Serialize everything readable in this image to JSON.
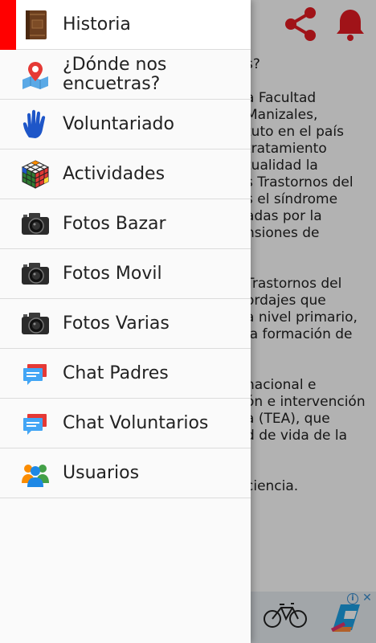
{
  "background": {
    "text_lines": [
      "s?",
      "",
      "a Facultad",
      "Manizales,",
      "tuto en el país",
      "tratamiento",
      "tualidad la",
      "s Trastornos del",
      "s el síndrome",
      "adas por la",
      "nsiones de",
      "",
      "",
      "Trastornos del",
      "ordajes que",
      "a nivel primario,",
      "la formación de",
      "",
      "",
      "nacional e",
      "ón e intervención",
      "a (TEA), que",
      "d de vida de la",
      "",
      "",
      "ciencia."
    ],
    "header_icons": [
      "share-icon",
      "bell-icon"
    ],
    "header_icon_color": "#e51c23",
    "ad": {
      "icons": [
        "bicycle-icon",
        "brand-logo-icon",
        "info-icon",
        "close-icon"
      ],
      "info_glyph": "i",
      "close_glyph": "✕"
    }
  },
  "drawer": {
    "active_color": "#ff0000",
    "items": [
      {
        "label": "Historia",
        "icon": "book-icon"
      },
      {
        "label": "¿Dónde nos encuetras?",
        "icon": "map-pin-icon"
      },
      {
        "label": "Voluntariado",
        "icon": "hand-icon"
      },
      {
        "label": "Actividades",
        "icon": "rubiks-cube-icon"
      },
      {
        "label": "Fotos Bazar",
        "icon": "camera-icon"
      },
      {
        "label": "Fotos Movil",
        "icon": "camera-icon"
      },
      {
        "label": "Fotos Varias",
        "icon": "camera-icon"
      },
      {
        "label": "Chat Padres",
        "icon": "chat-icon"
      },
      {
        "label": "Chat Voluntarios",
        "icon": "chat-icon"
      },
      {
        "label": "Usuarios",
        "icon": "users-icon"
      }
    ]
  }
}
